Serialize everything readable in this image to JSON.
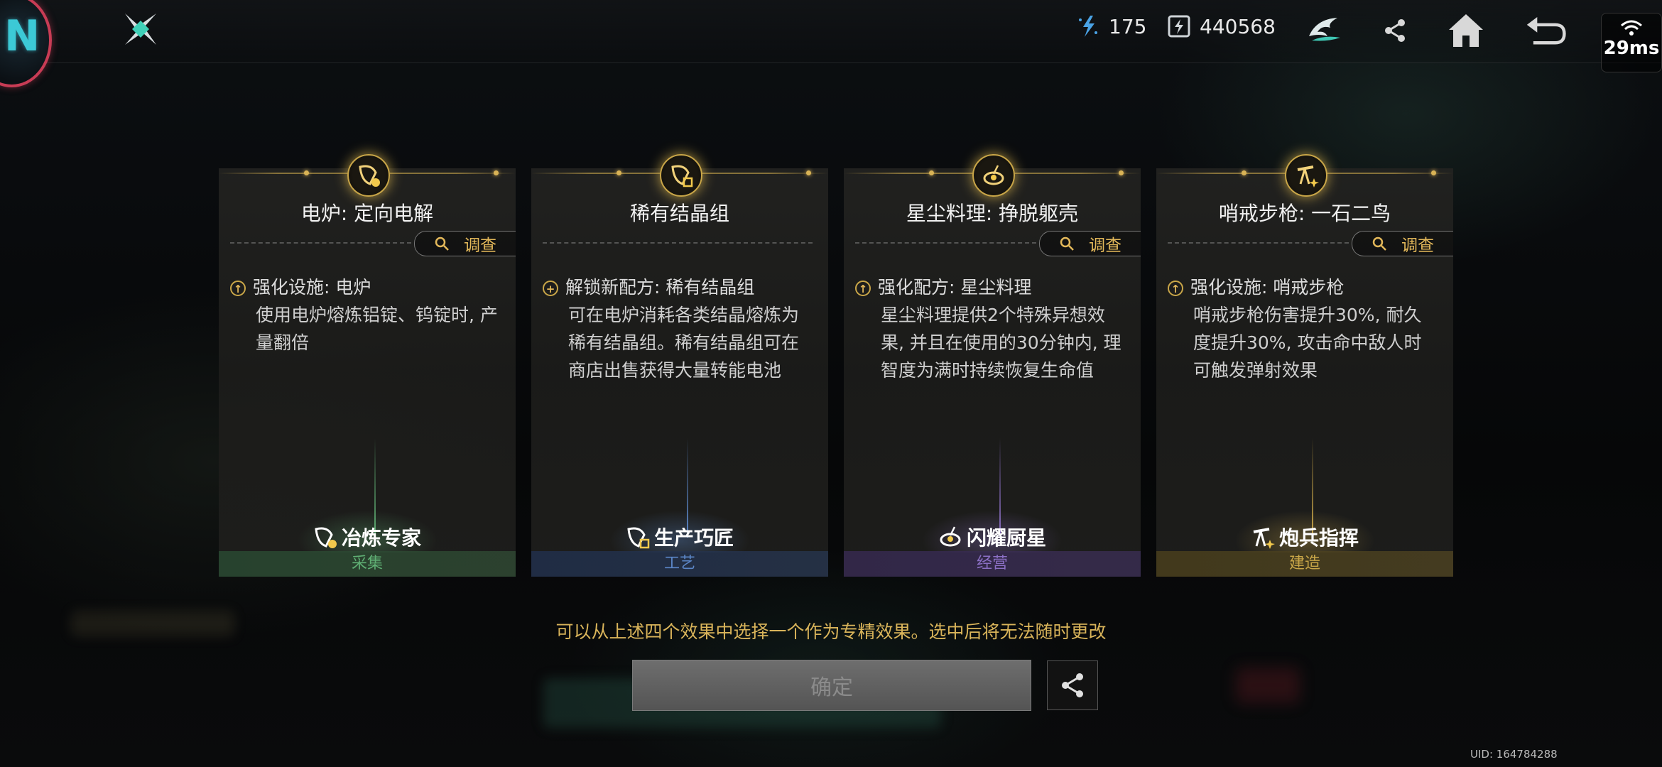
{
  "header": {
    "resource_1": {
      "icon": "energy-crystal-icon",
      "value": "175"
    },
    "resource_2": {
      "icon": "battery-icon",
      "value": "440568"
    },
    "network": {
      "ping": "29ms"
    }
  },
  "cards": [
    {
      "title": "电炉: 定向电解",
      "investigate_label": "调查",
      "effect_head": "强化设施: 电炉",
      "effect_body": "使用电炉熔炼铝锭、钨锭时, 产量翻倍",
      "specialist": "冶炼专家",
      "category": "采集",
      "accent": "#5fae73"
    },
    {
      "title": "稀有结晶组",
      "investigate_label": "",
      "effect_head": "解锁新配方: 稀有结晶组",
      "effect_body": "可在电炉消耗各类结晶熔炼为稀有结晶组。稀有结晶组可在商店出售获得大量转能电池",
      "specialist": "生产巧匠",
      "category": "工艺",
      "accent": "#5b86c7"
    },
    {
      "title": "星尘料理: 挣脱躯壳",
      "investigate_label": "调查",
      "effect_head": "强化配方: 星尘料理",
      "effect_body": "星尘料理提供2个特殊异想效果, 并且在使用的30分钟内, 理智度为满时持续恢复生命值",
      "specialist": "闪耀厨星",
      "category": "经营",
      "accent": "#8b6fc4"
    },
    {
      "title": "哨戒步枪: 一石二鸟",
      "investigate_label": "调查",
      "effect_head": "强化设施: 哨戒步枪",
      "effect_body": "哨戒步枪伤害提升30%, 耐久度提升30%, 攻击命中敌人时可触发弹射效果",
      "specialist": "炮兵指挥",
      "category": "建造",
      "accent": "#c9a648"
    }
  ],
  "hint": "可以从上述四个效果中选择一个作为专精效果。选中后将无法随时更改",
  "confirm_label": "确定",
  "uid": "UID: 164784288"
}
